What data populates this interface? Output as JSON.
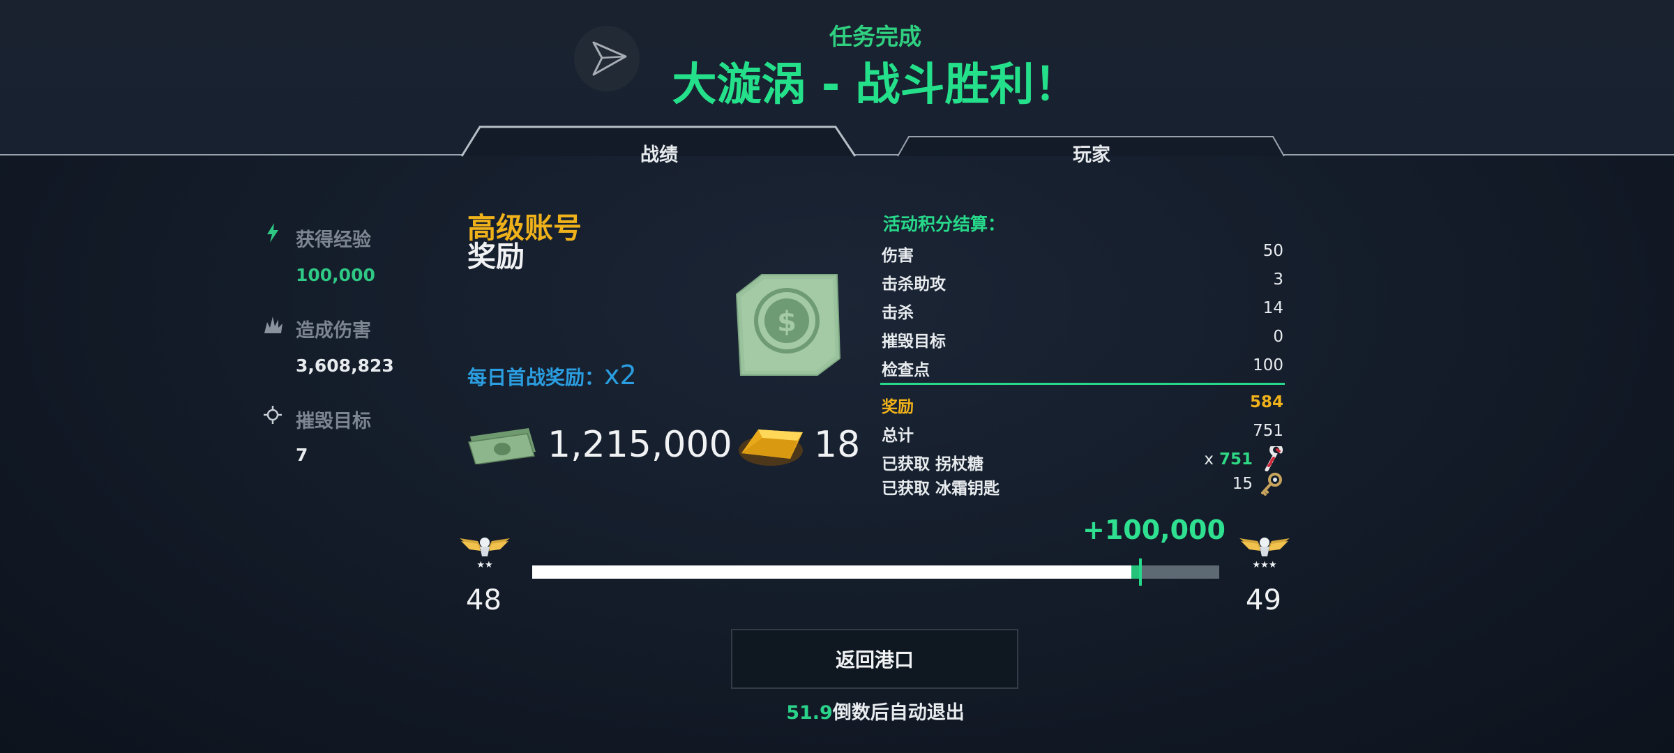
{
  "header": {
    "mission_complete": "任务完成",
    "battle_result": "大漩涡 - 战斗胜利！"
  },
  "tabs": [
    {
      "label": "战绩",
      "active": true
    },
    {
      "label": "玩家",
      "active": false
    }
  ],
  "stats": [
    {
      "icon": "lightning-icon",
      "label": "获得经验",
      "value": "100,000",
      "value_color": "#2fc884"
    },
    {
      "icon": "explosion-icon",
      "label": "造成伤害",
      "value": "3,608,823",
      "value_color": "#e8ecef"
    },
    {
      "icon": "crosshair-icon",
      "label": "摧毁目标",
      "value": "7",
      "value_color": "#e8ecef"
    }
  ],
  "premium": {
    "title": "高级账号",
    "subtitle": "奖励",
    "daily_bonus_label": "每日首战奖励：",
    "daily_bonus_mult": "x2",
    "credits": "1,215,000",
    "gold": "18"
  },
  "event": {
    "title": "活动积分结算：",
    "rows": [
      {
        "label": "伤害",
        "value": "50"
      },
      {
        "label": "击杀助攻",
        "value": "3"
      },
      {
        "label": "击杀",
        "value": "14"
      },
      {
        "label": "摧毁目标",
        "value": "0"
      },
      {
        "label": "检查点",
        "value": "100"
      }
    ],
    "reward": {
      "label": "奖励",
      "value": "584"
    },
    "total": {
      "label": "总计",
      "value": "751"
    },
    "obtained": [
      {
        "label": "已获取 拐杖糖",
        "prefix": "x",
        "value": "751",
        "icon": "candy-cane-icon"
      },
      {
        "label": "已获取 冰霜钥匙",
        "prefix": "",
        "value": "15",
        "icon": "frost-key-icon"
      }
    ]
  },
  "xp": {
    "gain": "+100,000",
    "current_level": "48",
    "next_level": "49",
    "progress": 0.885,
    "gain_fraction": 0.013
  },
  "actions": {
    "return_port": "返回港口",
    "countdown_value": "51.9",
    "countdown_text": "倒数后自动退出"
  },
  "colors": {
    "accent_green": "#25e08a",
    "gold": "#f0b21a",
    "blue": "#2a9ee0"
  }
}
